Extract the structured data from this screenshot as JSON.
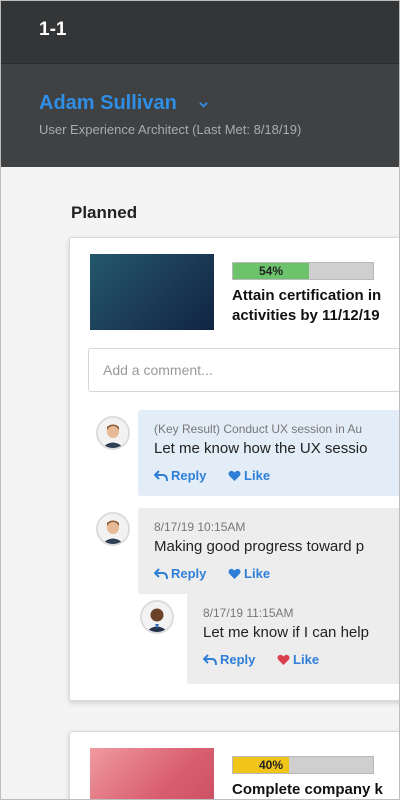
{
  "header": {
    "title": "1-1"
  },
  "profile": {
    "name": "Adam Sullivan",
    "subtitle": "User Experience Architect (Last Met: 8/18/19)"
  },
  "section": {
    "title": "Planned"
  },
  "goals": [
    {
      "progress_label": "54%",
      "progress": 0.54,
      "progress_color": "#6cc36c",
      "title_line1": "Attain certification in",
      "title_line2": "activities by 11/12/19",
      "comment_placeholder": "Add a comment...",
      "comments": [
        {
          "meta": "(Key Result) Conduct UX session in Au",
          "text": "Let me know how the UX sessio",
          "reply_label": "Reply",
          "like_label": "Like",
          "bubble_color": "#e3edf8"
        },
        {
          "meta": "8/17/19 10:15AM",
          "text": "Making good progress toward p",
          "reply_label": "Reply",
          "like_label": "Like",
          "bubble_color": "#ededed",
          "replies": [
            {
              "meta": "8/17/19 11:15AM",
              "text": "Let me know if I can help",
              "reply_label": "Reply",
              "like_label": "Like",
              "liked": true,
              "bubble_color": "#ededed"
            }
          ]
        }
      ]
    },
    {
      "progress_label": "40%",
      "progress": 0.4,
      "progress_color": "#f0c419",
      "title_line1": "Complete company k"
    }
  ],
  "colors": {
    "accent": "#2f7fd8",
    "like_red": "#d9414f",
    "topbar": "#333536"
  }
}
